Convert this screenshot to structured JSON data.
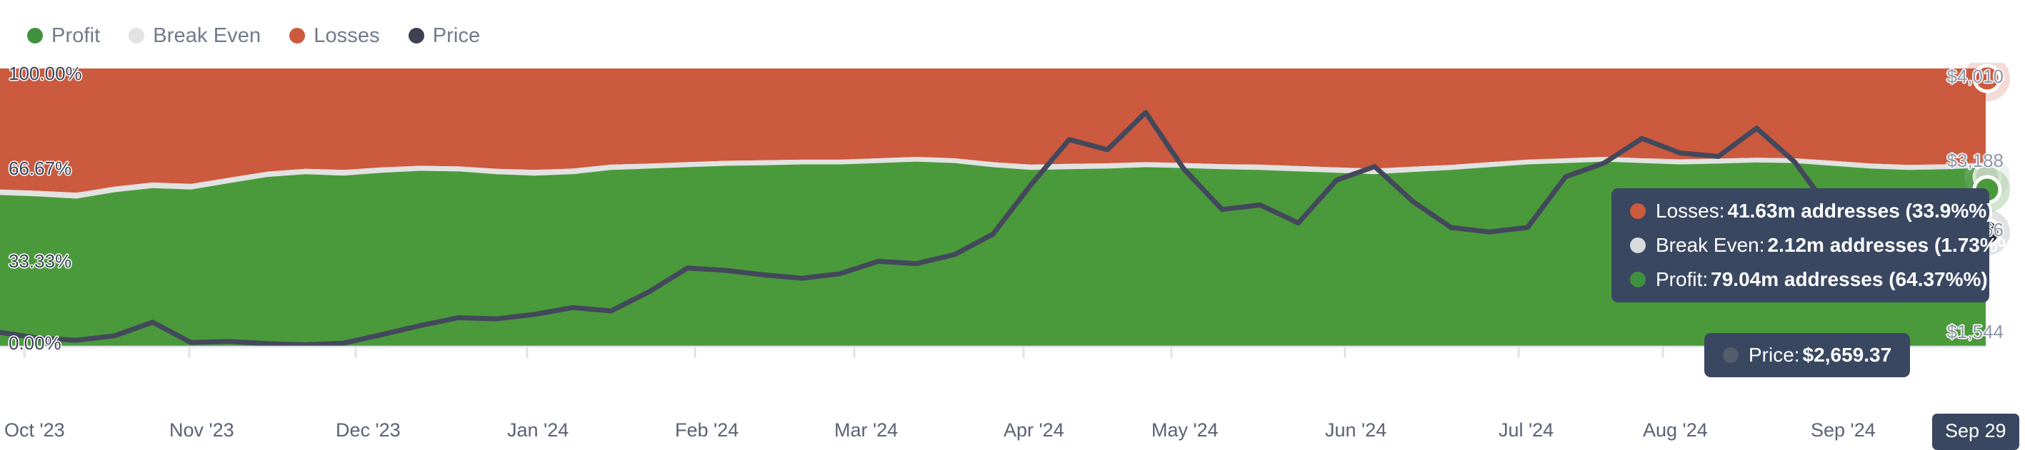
{
  "legend": {
    "items": [
      {
        "label": "Profit",
        "color": "#3f9140",
        "icon": "legend-dot-profit"
      },
      {
        "label": "Break Even",
        "color": "#e2e2e2",
        "icon": "legend-dot-break-even"
      },
      {
        "label": "Losses",
        "color": "#cc5a3e",
        "icon": "legend-dot-losses"
      },
      {
        "label": "Price",
        "color": "#3d4150",
        "icon": "legend-dot-price"
      }
    ]
  },
  "tooltip": {
    "losses": {
      "name": "Losses",
      "value": "41.63m addresses (33.9%%)",
      "color": "#cc5a3e"
    },
    "break_even": {
      "name": "Break Even",
      "value": "2.12m addresses (1.73%%)",
      "color": "#d8dade"
    },
    "profit": {
      "name": "Profit",
      "value": "79.04m addresses (64.37%%)",
      "color": "#3f9140"
    },
    "price": {
      "name": "Price",
      "value": "$2,659.37",
      "color": "#555c6b"
    },
    "separator": ": "
  },
  "axes": {
    "y_left": {
      "ticks": [
        "100.00%",
        "66.67%",
        "33.33%",
        "0.00%"
      ],
      "values": [
        100,
        66.67,
        33.33,
        0
      ]
    },
    "y_right": {
      "ticks": [
        "$4,010",
        "$3,188",
        "$2,366",
        "$1,544"
      ],
      "values": [
        4010,
        3188,
        2366,
        1544
      ]
    },
    "x": {
      "ticks": [
        "Oct '23",
        "Nov '23",
        "Dec '23",
        "Jan '24",
        "Feb '24",
        "Mar '24",
        "Apr '24",
        "May '24",
        "Jun '24",
        "Jul '24",
        "Aug '24",
        "Sep '24"
      ],
      "cursor_badge": "Sep 29"
    }
  },
  "chart_data": {
    "type": "area",
    "title": "",
    "subtitle": "",
    "xlabel": "",
    "ylabel": "",
    "ylim": [
      0,
      100
    ],
    "y2lim": [
      1544,
      4010
    ],
    "grid": false,
    "legend_position": "top-left",
    "stacked": true,
    "x": [
      "Oct '23",
      "Nov '23",
      "Dec '23",
      "Jan '24",
      "Feb '24",
      "Mar '24",
      "Apr '24",
      "May '24",
      "Jun '24",
      "Jul '24",
      "Aug '24",
      "Sep '24"
    ],
    "series": [
      {
        "name": "Profit",
        "color": "#3f9140",
        "unit": "%",
        "values": [
          54.5,
          54.0,
          53.2,
          55.5,
          57.0,
          56.5,
          58.8,
          61.0,
          62.0,
          61.5,
          62.5,
          63.2,
          63.0,
          62.0,
          61.5,
          62.0,
          63.5,
          64.0,
          64.5,
          65.0,
          65.2,
          65.5,
          65.5,
          66.0,
          66.5,
          66.0,
          64.5,
          63.5,
          63.8,
          64.0,
          64.5,
          64.2,
          63.8,
          63.5,
          63.0,
          62.5,
          62.0,
          62.8,
          63.5,
          64.5,
          65.5,
          66.0,
          66.5,
          66.0,
          65.5,
          65.8,
          66.2,
          66.0,
          65.0,
          64.0,
          63.5,
          63.8,
          64.37
        ]
      },
      {
        "name": "Break Even",
        "color": "#e2e2e2",
        "unit": "%",
        "values": [
          2.0,
          2.0,
          2.1,
          2.0,
          2.0,
          2.0,
          1.9,
          1.9,
          1.9,
          2.0,
          1.9,
          1.8,
          1.8,
          1.9,
          2.0,
          2.0,
          1.9,
          1.8,
          1.8,
          1.8,
          1.8,
          1.7,
          1.7,
          1.7,
          1.7,
          1.7,
          1.8,
          1.9,
          1.9,
          1.9,
          1.8,
          1.8,
          1.8,
          1.9,
          1.9,
          1.9,
          2.0,
          1.9,
          1.8,
          1.8,
          1.7,
          1.7,
          1.7,
          1.7,
          1.8,
          1.8,
          1.7,
          1.7,
          1.8,
          1.8,
          1.8,
          1.75,
          1.73
        ]
      },
      {
        "name": "Losses",
        "color": "#cc5a3e",
        "unit": "%",
        "values": [
          43.5,
          44.0,
          44.7,
          42.5,
          41.0,
          41.5,
          39.3,
          37.1,
          36.1,
          36.5,
          35.6,
          35.0,
          35.2,
          36.1,
          36.5,
          36.0,
          34.6,
          34.2,
          33.7,
          33.2,
          33.0,
          32.8,
          32.8,
          32.3,
          31.8,
          32.3,
          33.7,
          34.6,
          34.3,
          34.1,
          33.7,
          34.0,
          34.4,
          34.6,
          35.1,
          35.6,
          36.0,
          35.3,
          34.7,
          33.7,
          32.8,
          32.3,
          31.8,
          32.3,
          32.7,
          32.4,
          32.1,
          32.3,
          33.2,
          34.2,
          34.7,
          34.45,
          33.9
        ]
      },
      {
        "name": "Price",
        "color": "#3d4150",
        "axis": "right",
        "unit": "USD",
        "values": [
          1670,
          1620,
          1600,
          1640,
          1760,
          1580,
          1590,
          1570,
          1560,
          1575,
          1650,
          1730,
          1800,
          1790,
          1830,
          1890,
          1860,
          2030,
          2240,
          2220,
          2180,
          2150,
          2190,
          2300,
          2280,
          2360,
          2540,
          2980,
          3380,
          3290,
          3620,
          3120,
          2760,
          2800,
          2640,
          3020,
          3140,
          2830,
          2600,
          2560,
          2600,
          3050,
          3170,
          3390,
          3260,
          3230,
          3480,
          3180,
          2720,
          2480,
          2630,
          2560,
          2659.37
        ]
      }
    ],
    "cursor": {
      "x": "Sep 29",
      "price": 2659.37,
      "losses_pct": 33.9,
      "break_even_pct": 1.73,
      "profit_pct": 64.37,
      "losses_addresses": "41.63m",
      "break_even_addresses": "2.12m",
      "profit_addresses": "79.04m"
    }
  }
}
